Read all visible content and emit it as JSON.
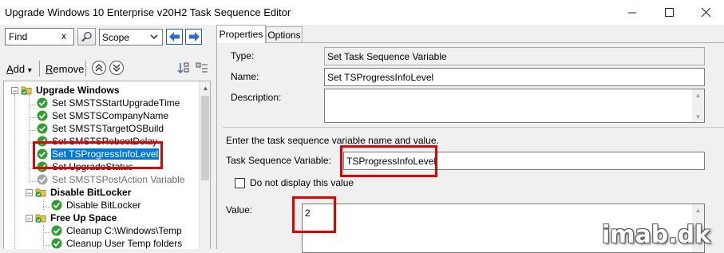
{
  "window": {
    "title": "Upgrade Windows 10 Enterprise v20H2 Task Sequence Editor",
    "minimize_icon": "minimize-icon",
    "maximize_icon": "maximize-icon",
    "close_icon": "close-icon"
  },
  "search": {
    "find_value": "Find",
    "clear_label": "x",
    "scope_value": "Scope"
  },
  "toolbar": {
    "add_underlined": "A",
    "add_rest": "dd",
    "add_arrow": "▾",
    "remove_underlined": "R",
    "remove_rest": "emove"
  },
  "tree": {
    "items": [
      {
        "label": "Upgrade Windows",
        "type": "group"
      },
      {
        "label": "Set SMSTSStartUpgradeTime",
        "type": "step"
      },
      {
        "label": "Set SMSTSCompanyName",
        "type": "step"
      },
      {
        "label": "Set SMSTSTargetOSBuild",
        "type": "step"
      },
      {
        "label": "Set SMSTSRebootDelay",
        "type": "step"
      },
      {
        "label": "Set TSProgressInfoLevel",
        "type": "step",
        "selected": true
      },
      {
        "label": "Set UpgradeStatus",
        "type": "step"
      },
      {
        "label": "Set SMSTSPostAction Variable",
        "type": "step",
        "disabled": true
      },
      {
        "label": "Disable BitLocker",
        "type": "group"
      },
      {
        "label": "Disable BitLocker",
        "type": "step"
      },
      {
        "label": "Free Up Space",
        "type": "group"
      },
      {
        "label": "Cleanup C:\\Windows\\Temp",
        "type": "step"
      },
      {
        "label": "Cleanup User Temp folders",
        "type": "step"
      }
    ]
  },
  "tabs": [
    {
      "label": "Properties",
      "active": true
    },
    {
      "label": "Options",
      "active": false
    }
  ],
  "properties": {
    "type_label": "Type:",
    "type_value": "Set Task Sequence Variable",
    "name_label": "Name:",
    "name_value": "Set TSProgressInfoLevel",
    "description_label": "Description:",
    "description_value": "",
    "instructions": "Enter the task sequence variable name and value.",
    "variable_label": "Task Sequence Variable:",
    "variable_value": "TSProgressInfoLevel",
    "hide_value_label": "Do not display this value",
    "hide_value_checked": false,
    "value_label": "Value:",
    "value_value": "2"
  },
  "watermark": "imab.dk",
  "colors": {
    "selection": "#0078d7",
    "callout": "#e00000",
    "step_check": "#2e9e2e"
  }
}
